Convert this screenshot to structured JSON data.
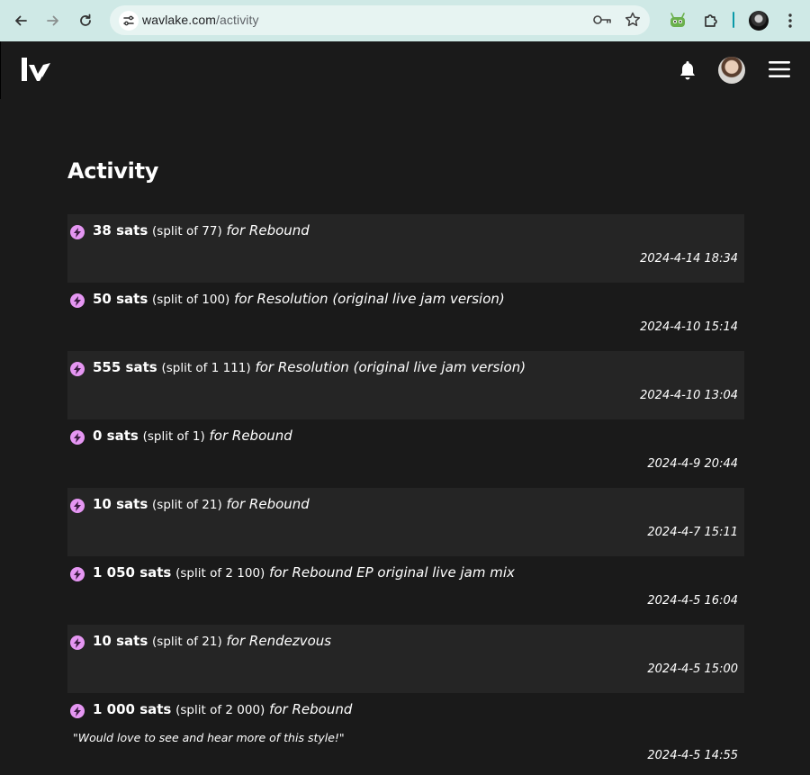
{
  "browser": {
    "url_host": "wavlake.com",
    "url_path": "/activity"
  },
  "page": {
    "title": "Activity"
  },
  "activity": [
    {
      "amount": "38 sats",
      "split": "(split of 77)",
      "track": "for Rebound",
      "date": "2024-4-14 18:34",
      "comment": ""
    },
    {
      "amount": "50 sats",
      "split": "(split of 100)",
      "track": "for Resolution (original live jam version)",
      "date": "2024-4-10 15:14",
      "comment": ""
    },
    {
      "amount": "555 sats",
      "split": "(split of 1 111)",
      "track": "for Resolution (original live jam version)",
      "date": "2024-4-10 13:04",
      "comment": ""
    },
    {
      "amount": "0 sats",
      "split": "(split of 1)",
      "track": "for Rebound",
      "date": "2024-4-9 20:44",
      "comment": ""
    },
    {
      "amount": "10 sats",
      "split": "(split of 21)",
      "track": "for Rebound",
      "date": "2024-4-7 15:11",
      "comment": ""
    },
    {
      "amount": "1 050 sats",
      "split": "(split of 2 100)",
      "track": "for Rebound EP original live jam mix",
      "date": "2024-4-5 16:04",
      "comment": ""
    },
    {
      "amount": "10 sats",
      "split": "(split of 21)",
      "track": "for Rendezvous",
      "date": "2024-4-5 15:00",
      "comment": ""
    },
    {
      "amount": "1 000 sats",
      "split": "(split of 2 000)",
      "track": "for Rebound",
      "date": "2024-4-5 14:55",
      "comment": "\"Would love to see and hear more of this style!\""
    }
  ],
  "colors": {
    "background": "#1a1a1a",
    "row_shade": "#252525",
    "bolt_accent": "#e596f2",
    "chrome": "#cfe9e6"
  },
  "icons": [
    "back-arrow-icon",
    "forward-arrow-icon",
    "reload-icon",
    "site-settings-icon",
    "password-key-icon",
    "bookmark-star-icon",
    "extension-robot-icon",
    "extensions-puzzle-icon",
    "profile-avatar-icon",
    "browser-menu-icon",
    "wavlake-logo",
    "bell-icon",
    "user-avatar",
    "hamburger-menu-icon",
    "lightning-bolt-icon"
  ]
}
